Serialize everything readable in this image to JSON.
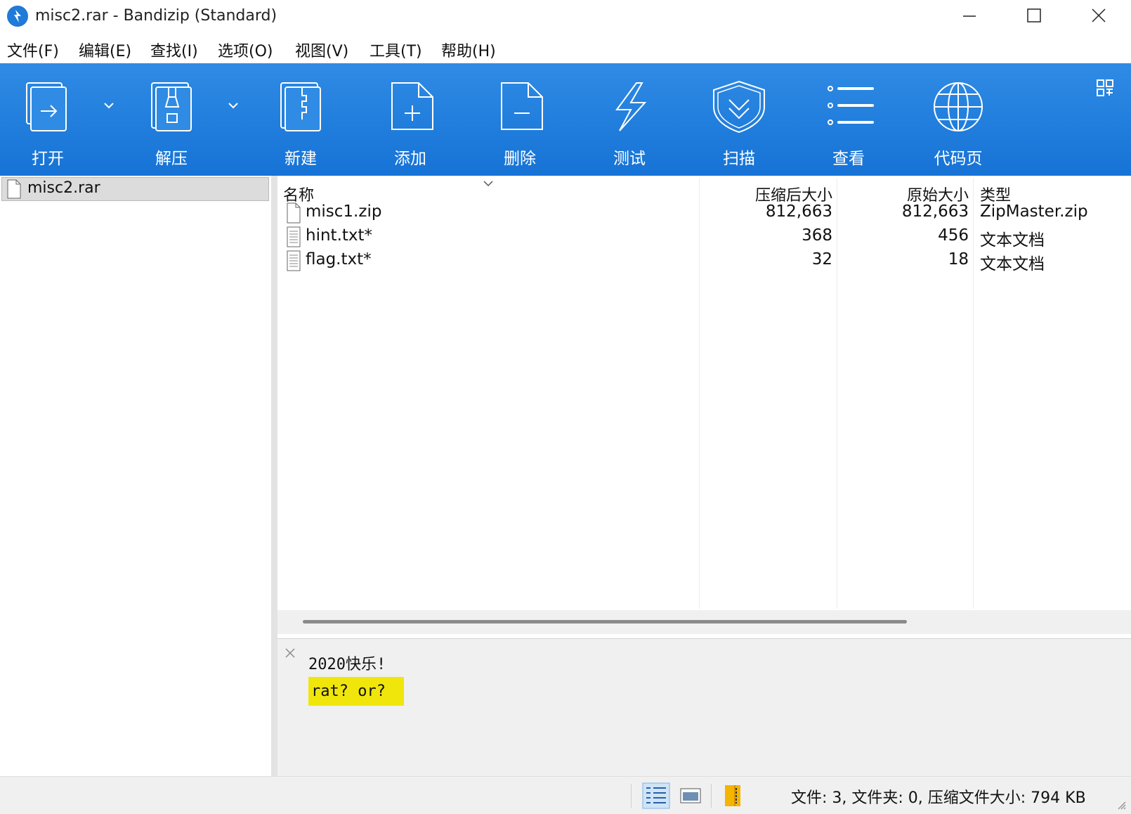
{
  "window": {
    "title": "misc2.rar - Bandizip (Standard)",
    "controls": [
      "minimize",
      "maximize",
      "close"
    ]
  },
  "menu": {
    "items": [
      "文件(F)",
      "编辑(E)",
      "查找(I)",
      "选项(O)",
      "视图(V)",
      "工具(T)",
      "帮助(H)"
    ]
  },
  "toolbar": {
    "buttons": [
      {
        "label": "打开",
        "icon": "open-archive-icon",
        "has_dropdown": true
      },
      {
        "label": "解压",
        "icon": "extract-icon",
        "has_dropdown": true
      },
      {
        "label": "新建",
        "icon": "new-archive-icon",
        "has_dropdown": false
      },
      {
        "label": "添加",
        "icon": "add-file-icon",
        "has_dropdown": false
      },
      {
        "label": "删除",
        "icon": "delete-file-icon",
        "has_dropdown": false
      },
      {
        "label": "测试",
        "icon": "test-lightning-icon",
        "has_dropdown": false
      },
      {
        "label": "扫描",
        "icon": "scan-shield-icon",
        "has_dropdown": false
      },
      {
        "label": "查看",
        "icon": "view-list-icon",
        "has_dropdown": false
      },
      {
        "label": "代码页",
        "icon": "codepage-globe-icon",
        "has_dropdown": false
      }
    ],
    "accent": "#1f7ad8"
  },
  "tree": {
    "items": [
      {
        "label": "misc2.rar",
        "selected": true
      }
    ]
  },
  "filelist": {
    "columns": {
      "name": "名称",
      "compressed": "压缩后大小",
      "original": "原始大小",
      "type": "类型"
    },
    "sort_column": "name",
    "rows": [
      {
        "name": "misc1.zip",
        "compressed": "812,663",
        "original": "812,663",
        "type": "ZipMaster.zip",
        "icon": "blank-file-icon"
      },
      {
        "name": "hint.txt*",
        "compressed": "368",
        "original": "456",
        "type": "文本文档",
        "icon": "text-file-icon"
      },
      {
        "name": "flag.txt*",
        "compressed": "32",
        "original": "18",
        "type": "文本文档",
        "icon": "text-file-icon"
      }
    ]
  },
  "comment": {
    "lines": [
      "2020快乐!",
      "rat? or?"
    ],
    "highlight_color": "#f0e60c"
  },
  "statusbar": {
    "text": "文件: 3, 文件夹: 0, 压缩文件大小: 794 KB"
  }
}
